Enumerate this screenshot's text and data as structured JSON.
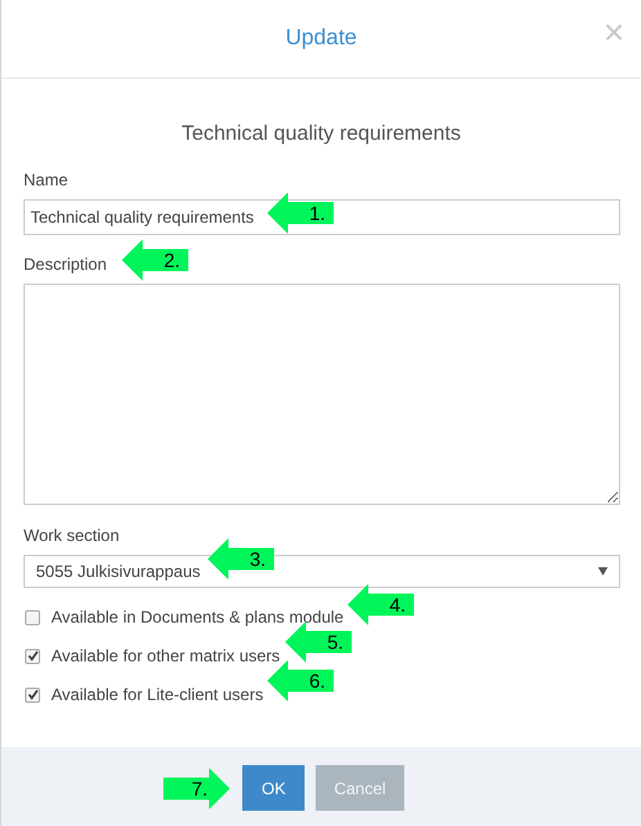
{
  "dialog": {
    "title": "Update",
    "close": "×"
  },
  "form": {
    "heading": "Technical quality requirements",
    "name": {
      "label": "Name",
      "value": "Technical quality requirements"
    },
    "description": {
      "label": "Description"
    },
    "work_section": {
      "label": "Work section",
      "value": "5055 Julkisivurappaus"
    },
    "options": [
      {
        "label": "Available in Documents & plans module",
        "checked": false
      },
      {
        "label": "Available for other matrix users",
        "checked": true
      },
      {
        "label": "Available for Lite-client users",
        "checked": true
      }
    ]
  },
  "buttons": [
    {
      "label": "OK",
      "kind": "primary"
    },
    {
      "label": "Cancel",
      "kind": "secondary"
    }
  ],
  "callouts": [
    {
      "label": "1.",
      "kind": "left"
    },
    {
      "label": "2.",
      "kind": "left"
    },
    {
      "label": "3.",
      "kind": "left"
    },
    {
      "label": "4.",
      "kind": "left"
    },
    {
      "label": "5.",
      "kind": "left"
    },
    {
      "label": "6.",
      "kind": "left"
    },
    {
      "label": "7.",
      "kind": "right"
    }
  ]
}
